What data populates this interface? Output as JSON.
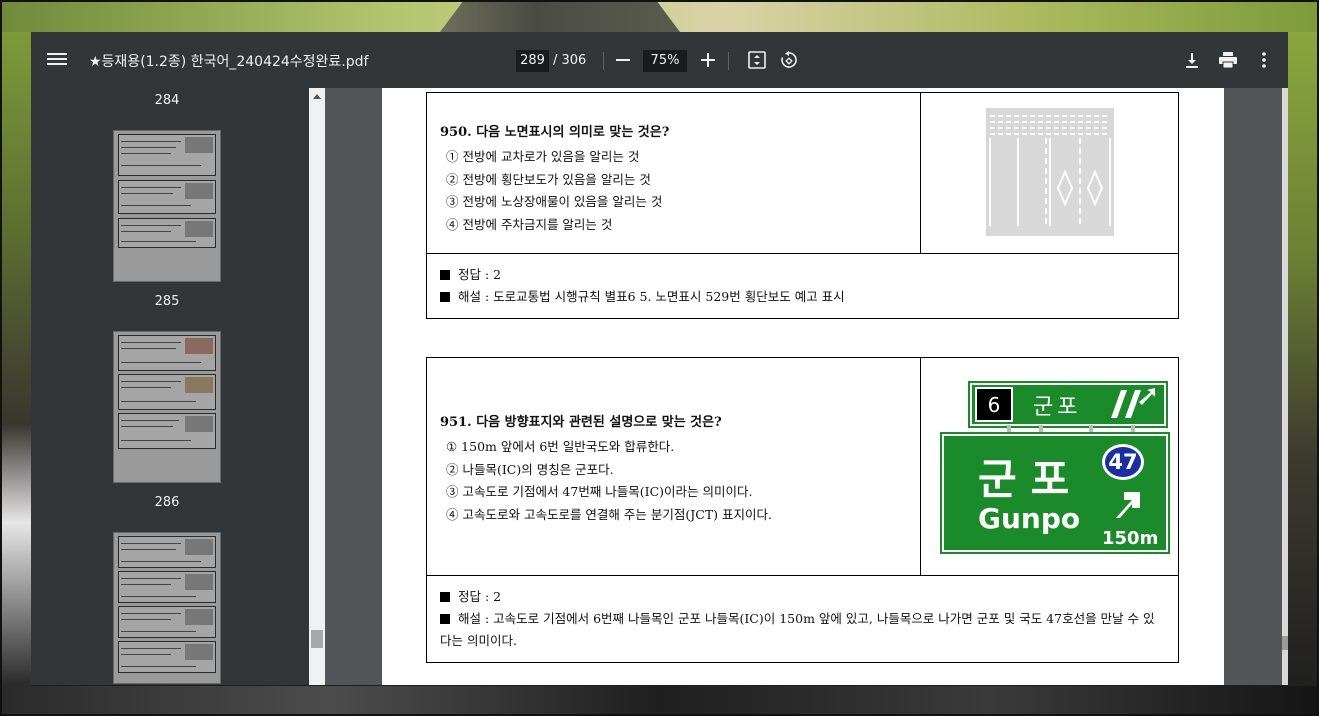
{
  "window": {
    "title": "★등재용(1.2종) 한국어_240424수정완료.pdf",
    "current_page": "289",
    "total_pages": "/ 306",
    "zoom": "75%"
  },
  "toolbar_icons": [
    "menu-icon",
    "zoom-out-icon",
    "zoom-in-icon",
    "fit-page-icon",
    "rotate-icon",
    "download-icon",
    "print-icon",
    "more-icon"
  ],
  "sidebar": {
    "labels": [
      "284",
      "285",
      "286"
    ]
  },
  "questions": [
    {
      "title": "950. 다음 노면표시의 의미로 맞는 것은?",
      "options": [
        "① 전방에 교차로가 있음을 알리는 것",
        "② 전방에 횡단보도가 있음을 알리는 것",
        "③ 전방에 노상장애물이 있음을 알리는 것",
        "④ 전방에 주차금지를 알리는 것"
      ],
      "answer": "정답 : 2",
      "explanation": "해설 : 도로교통법 시행규칙 별표6 5. 노면표시 529번 횡단보도 예고 표시"
    },
    {
      "title": "951. 다음 방향표지와 관련된 설명으로 맞는 것은?",
      "options": [
        "① 150m 앞에서 6번 일반국도와 합류한다.",
        "② 나들목(IC)의 명칭은 군포다.",
        "③ 고속도로 기점에서 47번째 나들목(IC)이라는 의미이다.",
        "④ 고속도로와 고속도로를 연결해 주는 분기점(JCT) 표지이다."
      ],
      "answer": "정답 : 2",
      "explanation": "해설 : 고속도로 기점에서 6번째 나들목인 군포 나들목(IC)이 150m 앞에 있고, 나들목으로 나가면 군포 및 국도 47호선을 만날 수 있다는 의미이다."
    }
  ],
  "sign": {
    "route_number": "6",
    "top_name": "군포",
    "main_korean": "군포",
    "main_english": "Gunpo",
    "exit_number": "47",
    "distance": "150m",
    "color": "#1a8a2a"
  }
}
